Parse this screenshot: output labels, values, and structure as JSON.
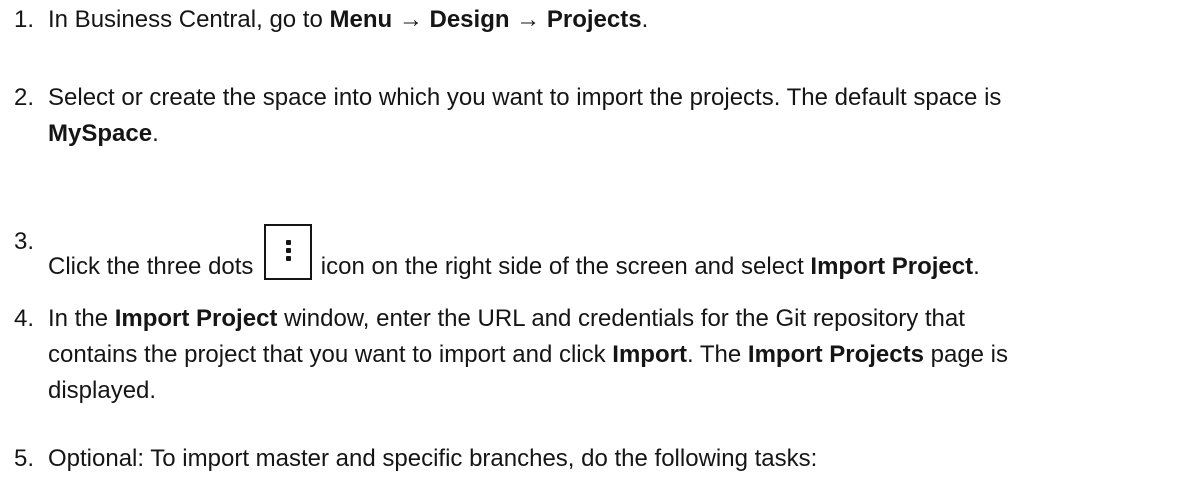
{
  "steps": [
    {
      "number": "1.",
      "parts": [
        "In Business Central, go to ",
        "Menu",
        " → ",
        "Design",
        " → ",
        "Projects",
        "."
      ]
    },
    {
      "number": "2.",
      "line1": "Select or create the space into which you want to import the projects. The default space is",
      "bold": "MySpace",
      "end": "."
    },
    {
      "number": "3.",
      "before": "Click the three dots ",
      "icon": "kebab-menu-icon",
      "after": " icon on the right side of the screen and select ",
      "bold": "Import Project",
      "end": "."
    },
    {
      "number": "4.",
      "a": "In the ",
      "b1": "Import Project",
      "c": " window, enter the URL and credentials for the Git repository that",
      "d": "contains the project that you want to import and click ",
      "b2": "Import",
      "e": ". The ",
      "b3": "Import Projects",
      "f": " page is",
      "g": "displayed."
    },
    {
      "number": "5.",
      "text": "Optional: To import master and specific branches, do the following tasks:"
    }
  ]
}
